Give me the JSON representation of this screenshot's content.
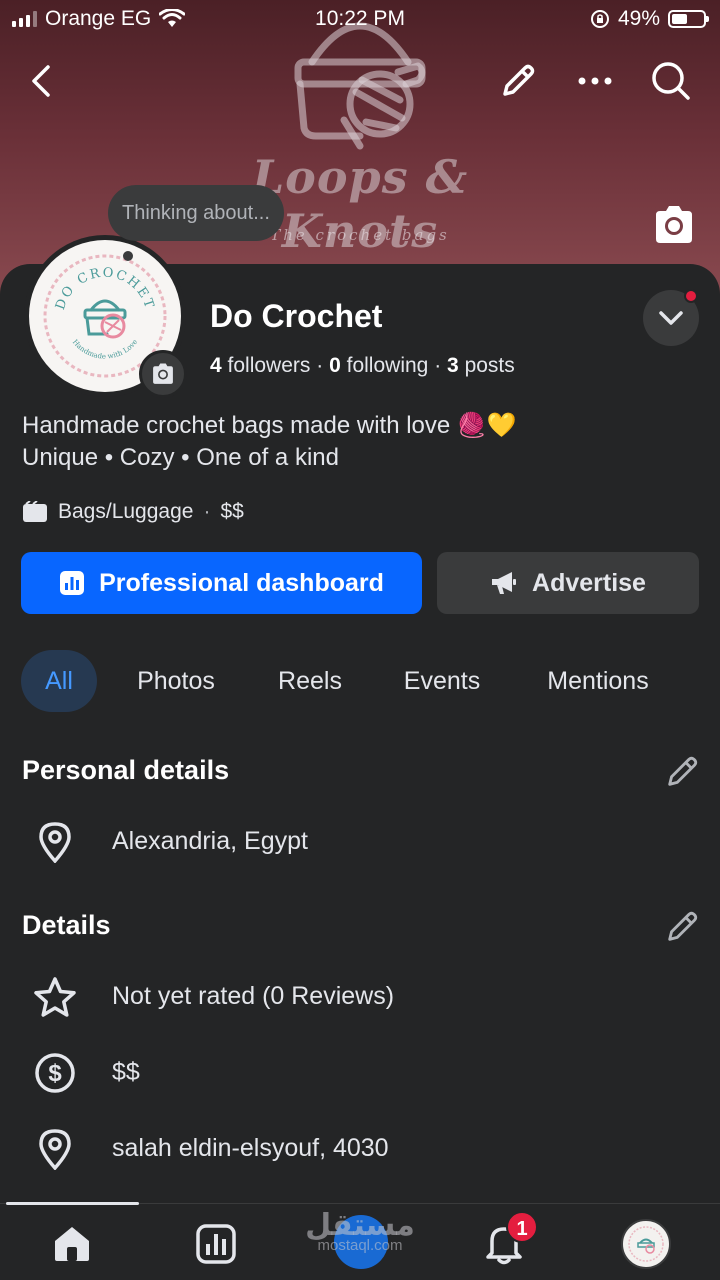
{
  "status_bar": {
    "carrier": "Orange EG",
    "time": "10:22 PM",
    "battery": "49%",
    "battery_level": 0.49
  },
  "cover": {
    "title": "Loops & Knots",
    "subtitle": "The crochet bags"
  },
  "avatar": {
    "text_top": "DO CROCHET",
    "text_bottom": "Handmade with Love"
  },
  "thinking_bubble": "Thinking about...",
  "profile": {
    "name": "Do Crochet",
    "followers_count": "4",
    "followers_label": "followers",
    "following_count": "0",
    "following_label": "following",
    "posts_count": "3",
    "posts_label": "posts",
    "separator": "·"
  },
  "bio": {
    "line1": "Handmade crochet bags made with love 🧶💛",
    "line2": "Unique • Cozy • One of a kind"
  },
  "category": {
    "name": "Bags/Luggage",
    "separator": "·",
    "price": "$$"
  },
  "buttons": {
    "professional_dashboard": "Professional dashboard",
    "advertise": "Advertise"
  },
  "tabs": [
    {
      "label": "All",
      "active": true
    },
    {
      "label": "Photos",
      "active": false
    },
    {
      "label": "Reels",
      "active": false
    },
    {
      "label": "Events",
      "active": false
    },
    {
      "label": "Mentions",
      "active": false
    }
  ],
  "personal_details": {
    "title": "Personal details",
    "location": "Alexandria, Egypt"
  },
  "details": {
    "title": "Details",
    "rating": "Not yet rated (0 Reviews)",
    "price": "$$",
    "address": "salah eldin-elsyouf, 4030"
  },
  "bottom_nav": {
    "notifications_badge": "1"
  },
  "watermark": {
    "arabic": "مستقل",
    "latin": "mostaql.com"
  },
  "colors": {
    "accent": "#0866ff",
    "background": "#242526",
    "surface": "#3a3b3c",
    "badge": "#e41e3f",
    "tab_active_bg": "#263951",
    "tab_active_text": "#4599ff"
  }
}
